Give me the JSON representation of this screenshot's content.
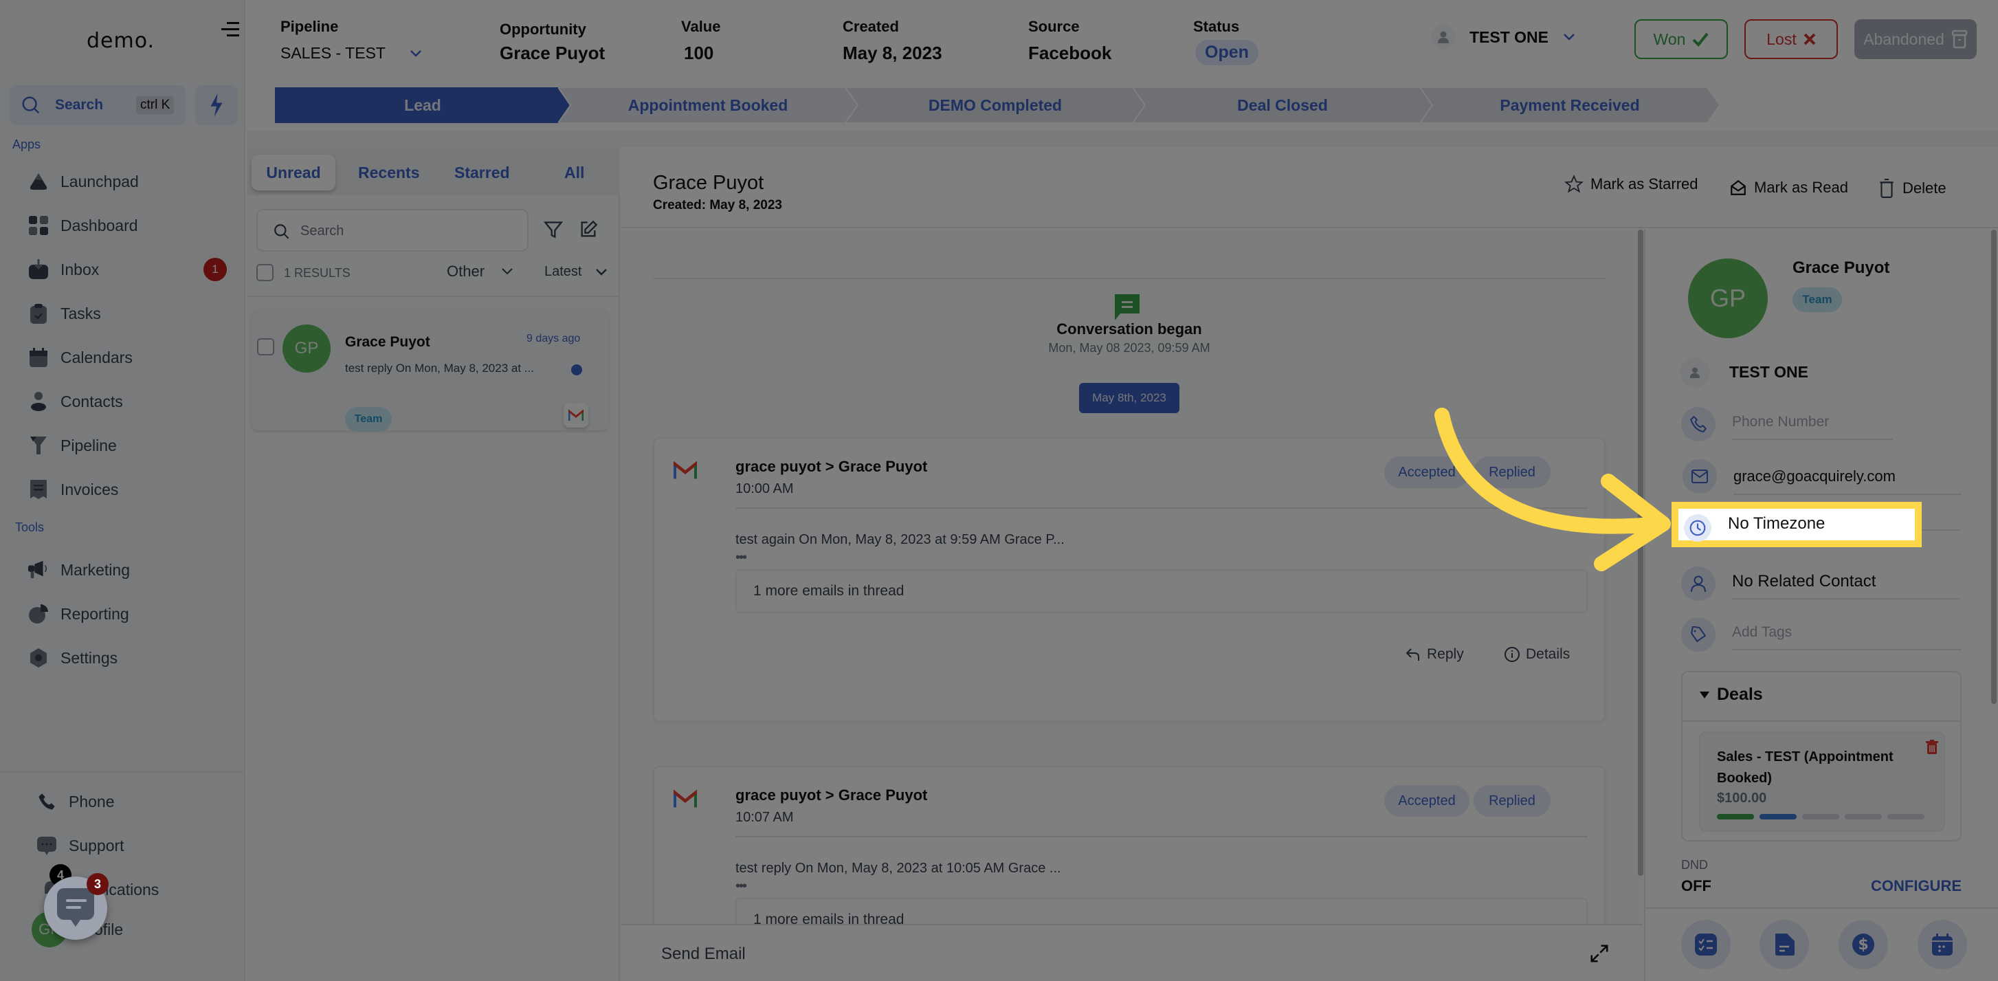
{
  "sidebar": {
    "logo": "demo.",
    "search_label": "Search",
    "search_shortcut": "ctrl K",
    "apps_label": "Apps",
    "tools_label": "Tools",
    "apps": [
      {
        "label": "Launchpad",
        "icon": "rocket-icon"
      },
      {
        "label": "Dashboard",
        "icon": "dashboard-icon"
      },
      {
        "label": "Inbox",
        "icon": "inbox-icon",
        "badge": "1"
      },
      {
        "label": "Tasks",
        "icon": "clipboard-check-icon"
      },
      {
        "label": "Calendars",
        "icon": "calendar-icon"
      },
      {
        "label": "Contacts",
        "icon": "person-icon"
      },
      {
        "label": "Pipeline",
        "icon": "funnel-icon"
      },
      {
        "label": "Invoices",
        "icon": "receipt-icon"
      }
    ],
    "tools": [
      {
        "label": "Marketing",
        "icon": "megaphone-icon"
      },
      {
        "label": "Reporting",
        "icon": "pie-chart-icon"
      },
      {
        "label": "Settings",
        "icon": "gear-icon"
      }
    ],
    "bottom": [
      {
        "label": "Phone",
        "icon": "phone-icon"
      },
      {
        "label": "Support",
        "icon": "chat-bubble-icon"
      },
      {
        "label": "Notifications",
        "icon": "bell-icon",
        "badge": "4"
      },
      {
        "label": "Profile",
        "avatar": "GP"
      }
    ],
    "chat_widget_badge": "3"
  },
  "header": {
    "pipeline": {
      "label": "Pipeline",
      "value": "SALES - TEST"
    },
    "opportunity": {
      "label": "Opportunity",
      "value": "Grace Puyot"
    },
    "value": {
      "label": "Value",
      "value": "100"
    },
    "created": {
      "label": "Created",
      "value": "May 8, 2023"
    },
    "source": {
      "label": "Source",
      "value": "Facebook"
    },
    "status": {
      "label": "Status",
      "value": "Open"
    },
    "assigned_user": "TEST ONE",
    "won_label": "Won",
    "lost_label": "Lost",
    "abandoned_label": "Abandoned"
  },
  "stages": [
    {
      "label": "Lead",
      "active": true
    },
    {
      "label": "Appointment Booked",
      "active": false
    },
    {
      "label": "DEMO Completed",
      "active": false
    },
    {
      "label": "Deal Closed",
      "active": false
    },
    {
      "label": "Payment Received",
      "active": false
    }
  ],
  "conversations": {
    "tabs": [
      "Unread",
      "Recents",
      "Starred",
      "All"
    ],
    "active_tab": "Unread",
    "search_placeholder": "Search",
    "results_count": "1 RESULTS",
    "filter_type": "Other",
    "sort": "Latest",
    "items": [
      {
        "initials": "GP",
        "name": "Grace Puyot",
        "time": "9 days ago",
        "preview": "test reply On Mon, May 8, 2023 at ...",
        "tag": "Team",
        "channel": "gmail",
        "unread": true
      }
    ]
  },
  "thread": {
    "title": "Grace Puyot",
    "created": "Created: May 8, 2023",
    "actions": {
      "star": "Mark as Starred",
      "read": "Mark as Read",
      "delete": "Delete"
    },
    "conversation_began": "Conversation began",
    "began_time": "Mon, May 08 2023, 09:59 AM",
    "date_chip": "May 8th, 2023",
    "emails": [
      {
        "from_to": "grace puyot > Grace Puyot",
        "time": "10:00 AM",
        "pills": [
          "Accepted",
          "Replied"
        ],
        "snippet": "test again On Mon, May 8, 2023 at 9:59 AM Grace P...",
        "more": "1 more emails in thread",
        "reply": "Reply",
        "details": "Details"
      },
      {
        "from_to": "grace puyot > Grace Puyot",
        "time": "10:07 AM",
        "pills": [
          "Accepted",
          "Replied"
        ],
        "snippet": "test reply On Mon, May 8, 2023 at 10:05 AM Grace ...",
        "more": "1 more emails in thread"
      }
    ],
    "compose_label": "Send Email"
  },
  "contact": {
    "initials": "GP",
    "name": "Grace Puyot",
    "tag": "Team",
    "owner": "TEST ONE",
    "phone_placeholder": "Phone Number",
    "email": "grace@goacquirely.com",
    "timezone": "No Timezone",
    "related_contact": "No Related Contact",
    "tags_placeholder": "Add Tags",
    "deals_label": "Deals",
    "deal": {
      "title": "Sales - TEST (Appointment Booked)",
      "amount": "$100.00",
      "stage_progress": {
        "completed": 2,
        "total": 5
      }
    },
    "dnd_label": "DND",
    "dnd_value": "OFF",
    "configure_label": "CONFIGURE"
  },
  "colors": {
    "accent": "#3b62c4",
    "won": "#3aa048",
    "lost": "#d23030",
    "highlight": "#fdd74a",
    "avatar": "#5cb85c"
  }
}
